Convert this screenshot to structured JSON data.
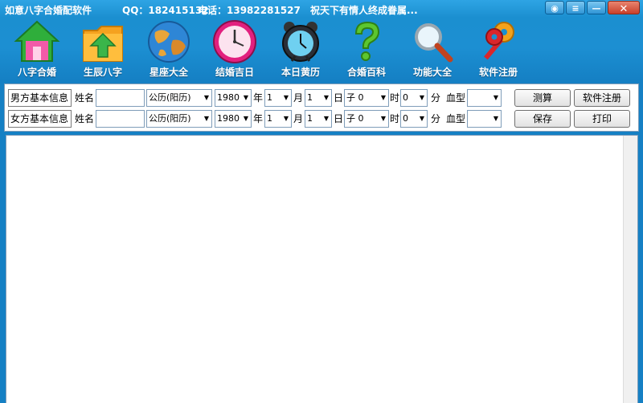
{
  "window": {
    "title": "如意八字合婚配软件",
    "qq": "QQ：182415132",
    "phone": "电话：13982281527",
    "slogan": "祝天下有情人终成眷属..."
  },
  "toolbar": {
    "items": [
      {
        "label": "八字合婚",
        "icon": "house-icon"
      },
      {
        "label": "生辰八字",
        "icon": "folder-up-icon"
      },
      {
        "label": "星座大全",
        "icon": "globe-icon"
      },
      {
        "label": "结婚吉日",
        "icon": "clock-icon"
      },
      {
        "label": "本日黄历",
        "icon": "alarm-clock-icon"
      },
      {
        "label": "合婚百科",
        "icon": "question-icon"
      },
      {
        "label": "功能大全",
        "icon": "magnifier-icon"
      },
      {
        "label": "软件注册",
        "icon": "keys-icon"
      }
    ]
  },
  "form": {
    "male": {
      "tag": "男方基本信息",
      "name_label": "姓名",
      "name_value": "",
      "calendar": "公历(阳历)",
      "year": "1980",
      "year_unit": "年",
      "month": "1",
      "month_unit": "月",
      "day": "1",
      "day_unit": "日",
      "hour": "子 0",
      "hour_unit": "时",
      "minute": "0",
      "minute_unit": "分",
      "blood_label": "血型",
      "blood": ""
    },
    "female": {
      "tag": "女方基本信息",
      "name_label": "姓名",
      "name_value": "",
      "calendar": "公历(阳历)",
      "year": "1980",
      "year_unit": "年",
      "month": "1",
      "month_unit": "月",
      "day": "1",
      "day_unit": "日",
      "hour": "子 0",
      "hour_unit": "时",
      "minute": "0",
      "minute_unit": "分",
      "blood_label": "血型",
      "blood": ""
    },
    "buttons": {
      "calculate": "测算",
      "register": "软件注册",
      "save": "保存",
      "print": "打印"
    }
  },
  "colors": {
    "title_bar": "#1b8fd0",
    "panel_border": "#7f9db9"
  }
}
